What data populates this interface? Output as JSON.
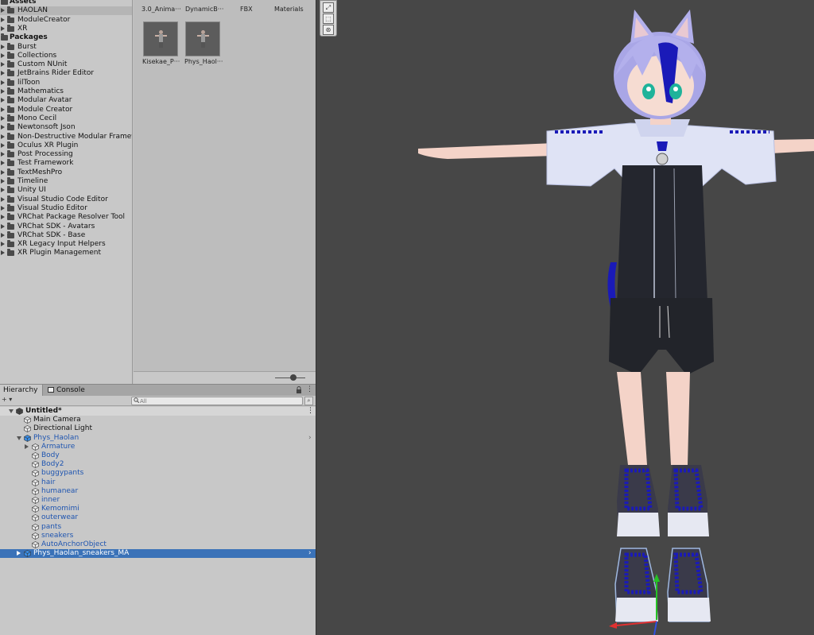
{
  "project_tree": {
    "items": [
      {
        "label": "Assets",
        "depth": 0,
        "root": true,
        "expanded": true,
        "selected": false
      },
      {
        "label": "HAOLAN",
        "depth": 1,
        "root": false,
        "expanded": false,
        "selected": true
      },
      {
        "label": "ModuleCreator",
        "depth": 1,
        "root": false,
        "expanded": false,
        "selected": false
      },
      {
        "label": "XR",
        "depth": 1,
        "root": false,
        "expanded": false,
        "selected": false
      },
      {
        "label": "Packages",
        "depth": 0,
        "root": true,
        "expanded": true,
        "selected": false
      },
      {
        "label": "Burst",
        "depth": 1,
        "root": false,
        "expanded": false,
        "selected": false
      },
      {
        "label": "Collections",
        "depth": 1,
        "root": false,
        "expanded": false,
        "selected": false
      },
      {
        "label": "Custom NUnit",
        "depth": 1,
        "root": false,
        "expanded": false,
        "selected": false
      },
      {
        "label": "JetBrains Rider Editor",
        "depth": 1,
        "root": false,
        "expanded": false,
        "selected": false
      },
      {
        "label": "lilToon",
        "depth": 1,
        "root": false,
        "expanded": false,
        "selected": false
      },
      {
        "label": "Mathematics",
        "depth": 1,
        "root": false,
        "expanded": false,
        "selected": false
      },
      {
        "label": "Modular Avatar",
        "depth": 1,
        "root": false,
        "expanded": false,
        "selected": false
      },
      {
        "label": "Module Creator",
        "depth": 1,
        "root": false,
        "expanded": false,
        "selected": false
      },
      {
        "label": "Mono Cecil",
        "depth": 1,
        "root": false,
        "expanded": false,
        "selected": false
      },
      {
        "label": "Newtonsoft Json",
        "depth": 1,
        "root": false,
        "expanded": false,
        "selected": false
      },
      {
        "label": "Non-Destructive Modular Framewo",
        "depth": 1,
        "root": false,
        "expanded": false,
        "selected": false
      },
      {
        "label": "Oculus XR Plugin",
        "depth": 1,
        "root": false,
        "expanded": false,
        "selected": false
      },
      {
        "label": "Post Processing",
        "depth": 1,
        "root": false,
        "expanded": false,
        "selected": false
      },
      {
        "label": "Test Framework",
        "depth": 1,
        "root": false,
        "expanded": false,
        "selected": false
      },
      {
        "label": "TextMeshPro",
        "depth": 1,
        "root": false,
        "expanded": false,
        "selected": false
      },
      {
        "label": "Timeline",
        "depth": 1,
        "root": false,
        "expanded": false,
        "selected": false
      },
      {
        "label": "Unity UI",
        "depth": 1,
        "root": false,
        "expanded": false,
        "selected": false
      },
      {
        "label": "Visual Studio Code Editor",
        "depth": 1,
        "root": false,
        "expanded": false,
        "selected": false
      },
      {
        "label": "Visual Studio Editor",
        "depth": 1,
        "root": false,
        "expanded": false,
        "selected": false
      },
      {
        "label": "VRChat Package Resolver Tool",
        "depth": 1,
        "root": false,
        "expanded": false,
        "selected": false
      },
      {
        "label": "VRChat SDK - Avatars",
        "depth": 1,
        "root": false,
        "expanded": false,
        "selected": false
      },
      {
        "label": "VRChat SDK - Base",
        "depth": 1,
        "root": false,
        "expanded": false,
        "selected": false
      },
      {
        "label": "XR Legacy Input Helpers",
        "depth": 1,
        "root": false,
        "expanded": false,
        "selected": false
      },
      {
        "label": "XR Plugin Management",
        "depth": 1,
        "root": false,
        "expanded": false,
        "selected": false
      }
    ]
  },
  "project_content": {
    "folders": [
      "3.0_Anima···",
      "DynamicB···",
      "FBX",
      "Materials"
    ],
    "assets": [
      "Kisekae_P···",
      "Phys_Haol···"
    ]
  },
  "hierarchy_tabs": {
    "hierarchy": "Hierarchy",
    "console": "Console",
    "lock_icon": "lock-icon",
    "menu_glyph": "⋮"
  },
  "hierarchy_search": {
    "add_label": "+ ▾",
    "placeholder": "All"
  },
  "hierarchy": {
    "items": [
      {
        "label": "Untitled*",
        "depth": 0,
        "type": "scene",
        "expander": "down",
        "selected": false,
        "blue": false
      },
      {
        "label": "Main Camera",
        "depth": 1,
        "type": "object",
        "expander": "none",
        "selected": false,
        "blue": false
      },
      {
        "label": "Directional Light",
        "depth": 1,
        "type": "object",
        "expander": "none",
        "selected": false,
        "blue": false
      },
      {
        "label": "Phys_Haolan",
        "depth": 1,
        "type": "prefab",
        "expander": "down",
        "selected": false,
        "blue": true
      },
      {
        "label": "Armature",
        "depth": 2,
        "type": "object",
        "expander": "right",
        "selected": false,
        "blue": true
      },
      {
        "label": "Body",
        "depth": 2,
        "type": "object",
        "expander": "none",
        "selected": false,
        "blue": true
      },
      {
        "label": "Body2",
        "depth": 2,
        "type": "object",
        "expander": "none",
        "selected": false,
        "blue": true
      },
      {
        "label": "buggypants",
        "depth": 2,
        "type": "object",
        "expander": "none",
        "selected": false,
        "blue": true
      },
      {
        "label": "hair",
        "depth": 2,
        "type": "object",
        "expander": "none",
        "selected": false,
        "blue": true
      },
      {
        "label": "humanear",
        "depth": 2,
        "type": "object",
        "expander": "none",
        "selected": false,
        "blue": true
      },
      {
        "label": "inner",
        "depth": 2,
        "type": "object",
        "expander": "none",
        "selected": false,
        "blue": true
      },
      {
        "label": "Kemomimi",
        "depth": 2,
        "type": "object",
        "expander": "none",
        "selected": false,
        "blue": true
      },
      {
        "label": "outerwear",
        "depth": 2,
        "type": "object",
        "expander": "none",
        "selected": false,
        "blue": true
      },
      {
        "label": "pants",
        "depth": 2,
        "type": "object",
        "expander": "none",
        "selected": false,
        "blue": true
      },
      {
        "label": "sneakers",
        "depth": 2,
        "type": "object",
        "expander": "none",
        "selected": false,
        "blue": true
      },
      {
        "label": "AutoAnchorObject",
        "depth": 2,
        "type": "object",
        "expander": "none",
        "selected": false,
        "blue": true
      },
      {
        "label": "Phys_Haolan_sneakers_MA",
        "depth": 1,
        "type": "prefab",
        "expander": "right",
        "selected": true,
        "blue": true
      }
    ]
  },
  "scene_tools": [
    "expand-icon",
    "rect-tool-icon",
    "orbit-icon"
  ],
  "colors": {
    "selection": "#3a72b8",
    "prefab_text": "#1f55b0",
    "scene_bg": "#474747"
  }
}
